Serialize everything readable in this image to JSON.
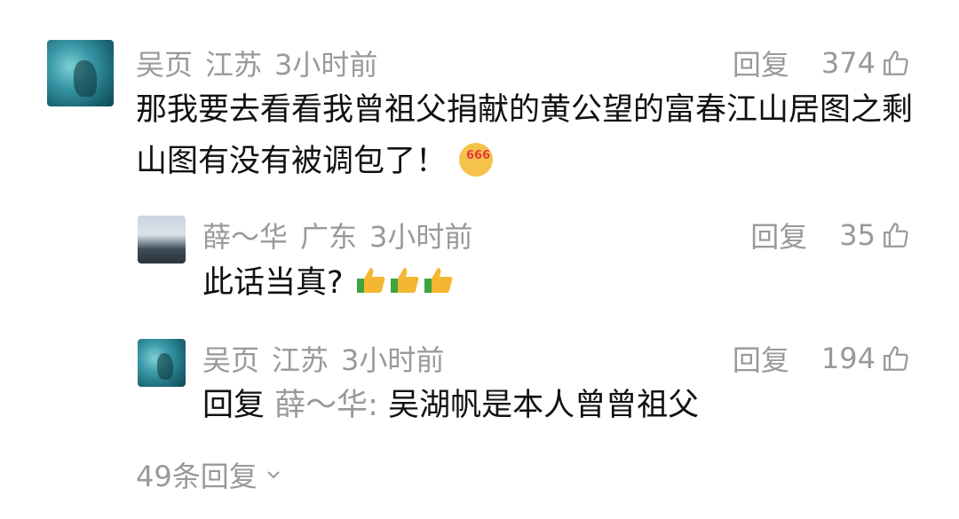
{
  "comments": [
    {
      "author": "吴页",
      "location": "江苏",
      "time": "3小时前",
      "reply_label": "回复",
      "likes": "374",
      "text": "那我要去看看我曾祖父捐献的黄公望的富春江山居图之剩山图有没有被调包了！"
    },
    {
      "author": "薛～华",
      "location": "广东",
      "time": "3小时前",
      "reply_label": "回复",
      "likes": "35",
      "text": "此话当真?"
    },
    {
      "author": "吴页",
      "location": "江苏",
      "time": "3小时前",
      "reply_label": "回复",
      "likes": "194",
      "reply_prefix": "回复",
      "reply_to": "薛～华:",
      "text": "吴湖帆是本人曾曾祖父"
    }
  ],
  "more_replies": "49条回复",
  "icons": {
    "like": "thumbs-up-outline-icon",
    "expand": "chevron-down-icon",
    "emoji_666": "smirk-666-emoji-icon",
    "thumbs_emoji": "thumbs-up-emoji-icon"
  }
}
